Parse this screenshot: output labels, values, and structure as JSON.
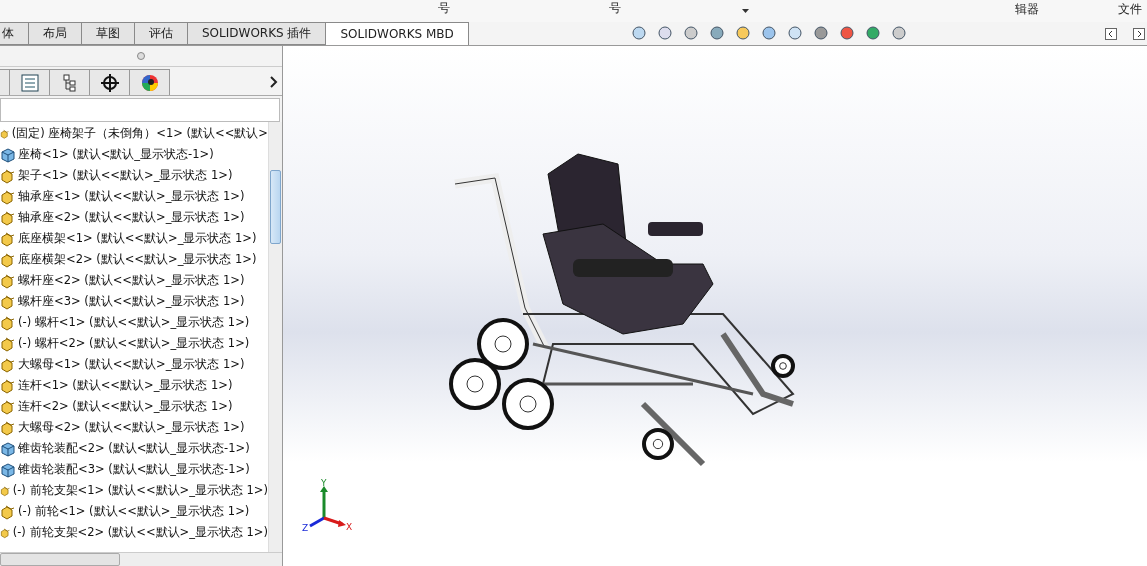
{
  "ribbon": {
    "labels": [
      "号",
      "号"
    ],
    "right_labels": [
      "辑器",
      "文件"
    ]
  },
  "tabs": [
    {
      "label": "体",
      "selected": false
    },
    {
      "label": "布局",
      "selected": false
    },
    {
      "label": "草图",
      "selected": false
    },
    {
      "label": "评估",
      "selected": false
    },
    {
      "label": "SOLIDWORKS 插件",
      "selected": false
    },
    {
      "label": "SOLIDWORKS MBD",
      "selected": true
    }
  ],
  "panel_tabs": [
    {
      "kind": "tree",
      "selected": false
    },
    {
      "kind": "property",
      "selected": false
    },
    {
      "kind": "config",
      "selected": false
    },
    {
      "kind": "dim",
      "selected": false
    },
    {
      "kind": "display",
      "selected": false
    }
  ],
  "tree": [
    {
      "kind": "part",
      "label": "(固定) 座椅架子（未倒角）<1> (默认<<默认>"
    },
    {
      "kind": "assembly",
      "label": "座椅<1> (默认<默认_显示状态-1>)"
    },
    {
      "kind": "part",
      "label": "架子<1> (默认<<默认>_显示状态 1>)"
    },
    {
      "kind": "part",
      "label": "轴承座<1> (默认<<默认>_显示状态 1>)"
    },
    {
      "kind": "part",
      "label": "轴承座<2> (默认<<默认>_显示状态 1>)"
    },
    {
      "kind": "part",
      "label": "底座横架<1> (默认<<默认>_显示状态 1>)"
    },
    {
      "kind": "part",
      "label": "底座横架<2> (默认<<默认>_显示状态 1>)"
    },
    {
      "kind": "part",
      "label": "螺杆座<2> (默认<<默认>_显示状态 1>)"
    },
    {
      "kind": "part",
      "label": "螺杆座<3> (默认<<默认>_显示状态 1>)"
    },
    {
      "kind": "part",
      "label": "(-) 螺杆<1> (默认<<默认>_显示状态 1>)"
    },
    {
      "kind": "part",
      "label": "(-) 螺杆<2> (默认<<默认>_显示状态 1>)"
    },
    {
      "kind": "part",
      "label": "大螺母<1> (默认<<默认>_显示状态 1>)"
    },
    {
      "kind": "part",
      "label": "连杆<1> (默认<<默认>_显示状态 1>)"
    },
    {
      "kind": "part",
      "label": "连杆<2> (默认<<默认>_显示状态 1>)"
    },
    {
      "kind": "part",
      "label": "大螺母<2> (默认<<默认>_显示状态 1>)"
    },
    {
      "kind": "assembly",
      "label": "锥齿轮装配<2> (默认<默认_显示状态-1>)"
    },
    {
      "kind": "assembly",
      "label": "锥齿轮装配<3> (默认<默认_显示状态-1>)"
    },
    {
      "kind": "part",
      "label": "(-) 前轮支架<1> (默认<<默认>_显示状态 1>)"
    },
    {
      "kind": "part",
      "label": "(-) 前轮<1> (默认<<默认>_显示状态 1>)"
    },
    {
      "kind": "part",
      "label": "(-) 前轮支架<2> (默认<<默认>_显示状态 1>)"
    }
  ],
  "triad": {
    "x": "X",
    "y": "Y",
    "z": "Z"
  }
}
